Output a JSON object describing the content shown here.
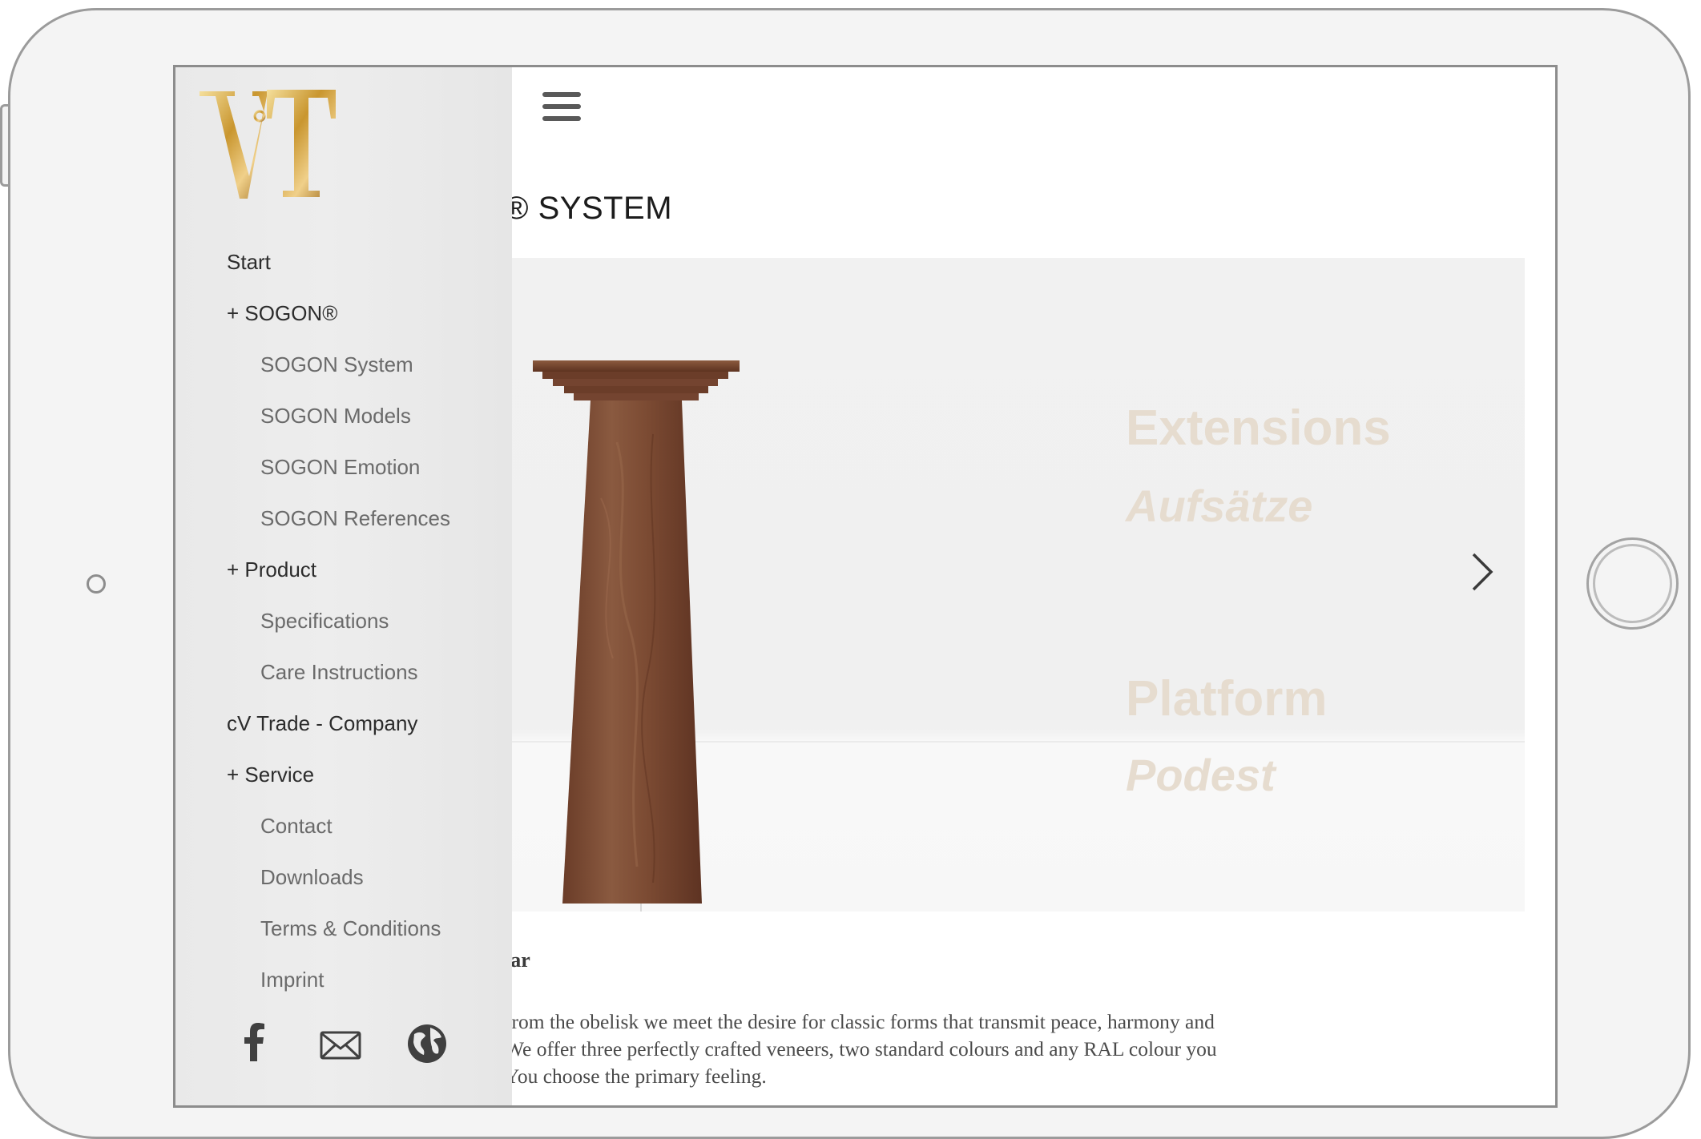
{
  "device": {
    "type": "tablet-landscape"
  },
  "drawer": {
    "logo_text": "VT",
    "nav": [
      {
        "label": "Start",
        "level": "top"
      },
      {
        "label": "+ SOGON®",
        "level": "top"
      },
      {
        "label": "SOGON System",
        "level": "sub"
      },
      {
        "label": "SOGON Models",
        "level": "sub"
      },
      {
        "label": "SOGON Emotion",
        "level": "sub"
      },
      {
        "label": "SOGON References",
        "level": "sub"
      },
      {
        "label": "+ Product",
        "level": "top"
      },
      {
        "label": "Specifications",
        "level": "sub"
      },
      {
        "label": "Care Instructions",
        "level": "sub"
      },
      {
        "label": "cV Trade - Company",
        "level": "top"
      },
      {
        "label": "+ Service",
        "level": "top"
      },
      {
        "label": "Contact",
        "level": "sub"
      },
      {
        "label": "Downloads",
        "level": "sub"
      },
      {
        "label": "Terms & Conditions",
        "level": "sub"
      },
      {
        "label": "Imprint",
        "level": "sub"
      }
    ],
    "social_icons": [
      "facebook-icon",
      "mail-icon",
      "globe-icon"
    ]
  },
  "header": {
    "menu_icon": "hamburger-icon"
  },
  "main": {
    "title": "® SYSTEM",
    "hero": {
      "labels": [
        "Extensions",
        "Aufsätze",
        "Platform",
        "Podest"
      ],
      "next_icon": "chevron-right-icon"
    },
    "section_heading": "lar",
    "body_lines": [
      "from the obelisk we meet the desire for classic forms that transmit peace, harmony and",
      "We offer three perfectly crafted veneers, two standard colours and any RAL colour you",
      "You choose the primary feeling."
    ]
  },
  "colors": {
    "gold": "#c9a24a",
    "walnut": "#7a4a33",
    "hero_text": "#e6dccf",
    "drawer_bg": "#ebebeb"
  }
}
